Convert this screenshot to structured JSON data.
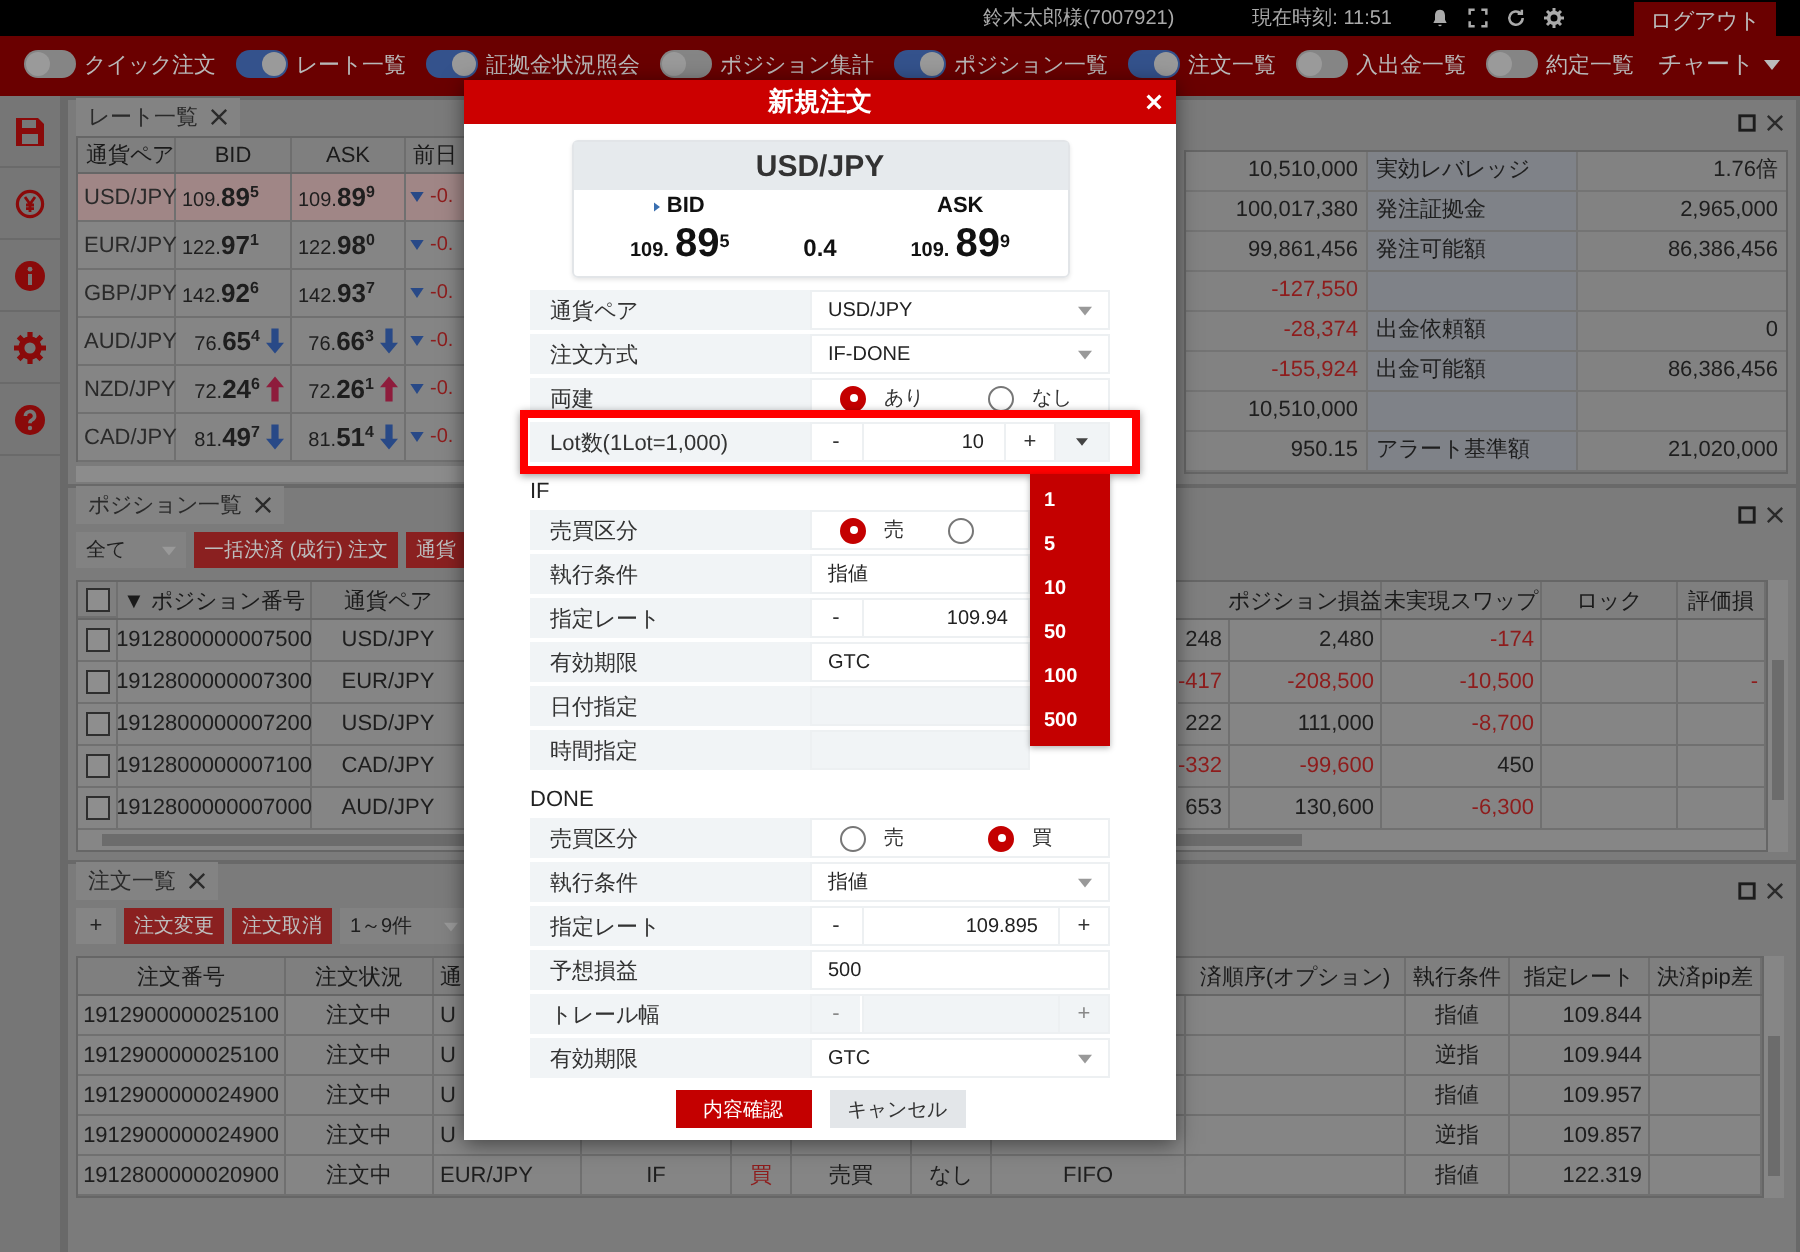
{
  "top_bar": {
    "user": "鈴木太郎様(7007921)",
    "clock": "現在時刻: 11:51",
    "logout": "ログアウト"
  },
  "toolbar": {
    "toggles": [
      {
        "label": "クイック注文",
        "on": false
      },
      {
        "label": "レート一覧",
        "on": true
      },
      {
        "label": "証拠金状況照会",
        "on": true
      },
      {
        "label": "ポジション集計",
        "on": false
      },
      {
        "label": "ポジション一覧",
        "on": true
      },
      {
        "label": "注文一覧",
        "on": true
      },
      {
        "label": "入出金一覧",
        "on": false
      },
      {
        "label": "約定一覧",
        "on": false
      }
    ],
    "chart_menu": "チャート"
  },
  "rate_panel": {
    "title": "レート一覧",
    "columns": [
      "通貨ペア",
      "BID",
      "ASK",
      "前日"
    ],
    "rows": [
      {
        "pair": "USD/JPY",
        "selected": true,
        "bid": "109.**89**$^{5}$",
        "ask": "109.**89**$^{9}$",
        "change": "-0."
      },
      {
        "pair": "EUR/JPY",
        "selected": false,
        "bid": "122.**97**$^{1}$",
        "ask": "122.**98**$^{0}$",
        "change": "-0."
      },
      {
        "pair": "GBP/JPY",
        "selected": false,
        "bid": "142.**92**$^{6}$",
        "ask": "142.**93**$^{7}$",
        "change": "-0."
      },
      {
        "pair": "AUD/JPY",
        "selected": false,
        "bid": "76.**65**$^{4}$",
        "bid_up": false,
        "ask": "76.**66**$^{3}$",
        "ask_up": false,
        "change": "-0."
      },
      {
        "pair": "NZD/JPY",
        "selected": false,
        "bid": "72.**24**$^{6}$",
        "bid_up": true,
        "ask": "72.**26**$^{1}$",
        "ask_up": true,
        "change": "-0."
      },
      {
        "pair": "CAD/JPY",
        "selected": false,
        "bid": "81.**49**$^{7}$",
        "bid_up": false,
        "ask": "81.**51**$^{4}$",
        "ask_up": false,
        "change": "-0."
      }
    ]
  },
  "account_panel": {
    "rows": [
      {
        "column_1": "10,510,000",
        "negative": false,
        "label": "実効レバレッジ",
        "amount": "1.76倍"
      },
      {
        "column_1": "100,017,380",
        "negative": false,
        "label": "発注証拠金",
        "amount": "2,965,000"
      },
      {
        "column_1": "99,861,456",
        "negative": false,
        "label": "発注可能額",
        "amount": "86,386,456"
      },
      {
        "column_1": "-127,550",
        "negative": true
      },
      {
        "column_1": "-28,374",
        "negative": true,
        "label": "出金依頼額",
        "amount": "0"
      },
      {
        "column_1": "-155,924",
        "negative": true,
        "label": "出金可能額",
        "amount": "86,386,456"
      },
      {
        "column_1": "10,510,000",
        "negative": false
      },
      {
        "column_1": "950.15",
        "negative": false,
        "label": "アラート基準額",
        "amount": "21,020,000"
      }
    ]
  },
  "positions_panel": {
    "title": "ポジション一覧",
    "filter": "全て",
    "buttons": [
      "一括決済 (成行) 注文",
      "通貨"
    ],
    "select_all": false,
    "columns": {
      "number": "▼ ポジション番号",
      "pair": "通貨ペア",
      "profit": "ポジション損益",
      "swap": "未実現スワップ",
      "lock": "ロック",
      "valuation": "評価損"
    },
    "rows": [
      {
        "checked": false,
        "number": "1912800000007500",
        "pair": "USD/JPY",
        "column_4": {
          "text": "248",
          "negative": false
        },
        "profit": {
          "text": "2,480",
          "negative": false
        },
        "swap": {
          "text": "-174",
          "negative": true
        }
      },
      {
        "checked": false,
        "number": "1912800000007300",
        "pair": "EUR/JPY",
        "column_4": {
          "text": "-417",
          "negative": true
        },
        "profit": {
          "text": "-208,500",
          "negative": true
        },
        "swap": {
          "text": "-10,500",
          "negative": true
        },
        "valuation": {
          "text": "-",
          "negative": true
        }
      },
      {
        "checked": false,
        "number": "1912800000007200",
        "pair": "USD/JPY",
        "column_4": {
          "text": "222",
          "negative": false
        },
        "profit": {
          "text": "111,000",
          "negative": false
        },
        "swap": {
          "text": "-8,700",
          "negative": true
        }
      },
      {
        "checked": false,
        "number": "1912800000007100",
        "pair": "CAD/JPY",
        "column_4": {
          "text": "-332",
          "negative": true
        },
        "profit": {
          "text": "-99,600",
          "negative": true
        },
        "swap": {
          "text": "450",
          "negative": false
        }
      },
      {
        "checked": false,
        "number": "1912800000007000",
        "pair": "AUD/JPY",
        "column_4": {
          "text": "653",
          "negative": false
        },
        "profit": {
          "text": "130,600",
          "negative": false
        },
        "swap": {
          "text": "-6,300",
          "negative": true
        }
      }
    ]
  },
  "orders_panel": {
    "title": "注文一覧",
    "add": "+",
    "buttons": [
      "注文変更",
      "注文取消"
    ],
    "range": "1～9件",
    "columns": {
      "number": "注文番号",
      "status": "注文状況",
      "pair": "通",
      "settle_order": "済順序(オプション)",
      "condition": "執行条件",
      "rate": "指定レート",
      "pip_diff": "決済pip差"
    },
    "rows": [
      {
        "number": "1912900000025100",
        "status": "注文中",
        "pair": "U",
        "condition": "指値",
        "rate": "109.844"
      },
      {
        "number": "1912900000025100",
        "status": "注文中",
        "pair": "U",
        "condition": "逆指",
        "rate": "109.944"
      },
      {
        "number": "1912900000024900",
        "status": "注文中",
        "pair": "U",
        "condition": "指値",
        "rate": "109.957"
      },
      {
        "number": "1912900000024900",
        "status": "注文中",
        "pair": "U",
        "condition": "逆指",
        "rate": "109.857"
      },
      {
        "number": "1912800000020900",
        "status": "注文中",
        "pair": "EUR/JPY",
        "column_4": "IF",
        "column_5": {
          "text": "買",
          "kind": "buy"
        },
        "column_6": "売買",
        "column_7": "なし",
        "column_8": "FIFO",
        "condition": "指値",
        "rate": "122.319"
      }
    ]
  },
  "dialog": {
    "title": "新規注文",
    "quote": {
      "pair": "USD/JPY",
      "bid_label": "BID",
      "bid": {
        "base": "109.",
        "big": "89",
        "pip": "5"
      },
      "spread": "0.4",
      "ask_label": "ASK",
      "ask": {
        "base": "109.",
        "big": "89",
        "pip": "9"
      }
    },
    "fields": [
      {
        "kind": "select",
        "label": "通貨ペア",
        "value": "USD/JPY"
      },
      {
        "kind": "select",
        "label": "注文方式",
        "value": "IF-DONE"
      },
      {
        "kind": "radio",
        "label": "両建",
        "options": [
          {
            "label": "あり",
            "selected": true
          },
          {
            "label": "なし",
            "selected": false
          }
        ]
      },
      {
        "kind": "stepper",
        "label": "Lot数(1Lot=1,000)",
        "minus": "-",
        "value": "10",
        "plus": "+",
        "disabled": false,
        "highlighted": true,
        "expanded": true,
        "menu": [
          "1",
          "5",
          "10",
          "50",
          "100",
          "500"
        ]
      }
    ],
    "sections": [
      {
        "title": "IF",
        "fields": [
          {
            "kind": "radio",
            "label": "売買区分",
            "options": [
              {
                "label": "売",
                "selected": true
              },
              {
                "selected": false
              }
            ]
          },
          {
            "kind": "text",
            "label": "執行条件",
            "value": "指値"
          },
          {
            "kind": "stepper",
            "label": "指定レート",
            "minus": "-",
            "value": "109.94",
            "disabled": false
          },
          {
            "kind": "text",
            "label": "有効期限",
            "value": "GTC"
          },
          {
            "kind": "blank",
            "label": "日付指定"
          },
          {
            "kind": "blank",
            "label": "時間指定"
          }
        ]
      },
      {
        "title": "DONE",
        "fields": [
          {
            "kind": "radio",
            "label": "売買区分",
            "options": [
              {
                "label": "売",
                "selected": false
              },
              {
                "label": "買",
                "selected": true
              }
            ]
          },
          {
            "kind": "select",
            "label": "執行条件",
            "value": "指値"
          },
          {
            "kind": "stepper",
            "label": "指定レート",
            "minus": "-",
            "value": "109.895",
            "plus": "+",
            "disabled": false
          },
          {
            "kind": "text",
            "label": "予想損益",
            "value": "500"
          },
          {
            "kind": "stepper",
            "label": "トレール幅",
            "minus": "-",
            "plus": "+",
            "disabled": true
          },
          {
            "kind": "select",
            "label": "有効期限",
            "value": "GTC"
          }
        ]
      }
    ],
    "buttons": [
      {
        "label": "内容確認",
        "kind": "primary"
      },
      {
        "label": "キャンセル",
        "kind": "secondary"
      }
    ]
  }
}
